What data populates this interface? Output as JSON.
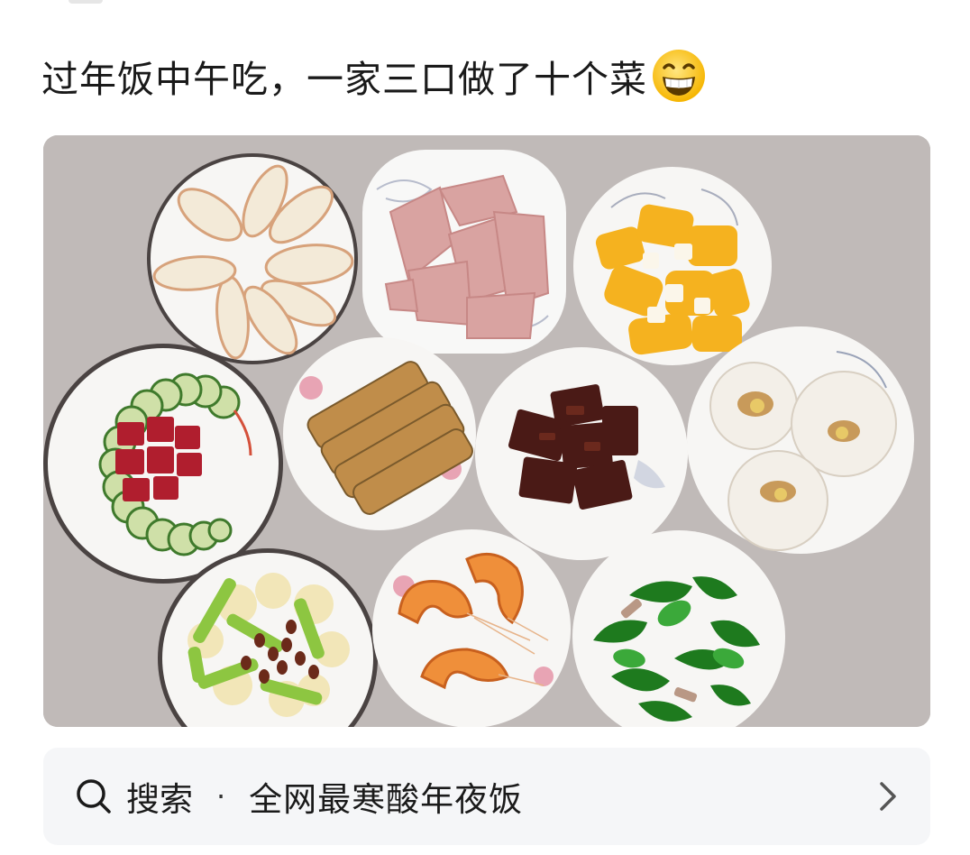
{
  "post": {
    "title": "过年饭中午吃，一家三口做了十个菜",
    "title_emoji": "grinning-face-emoji"
  },
  "photo": {
    "subject": "dishes-photo"
  },
  "search": {
    "label": "搜索",
    "separator": "·",
    "query": "全网最寒酸年夜饭"
  },
  "colors": {
    "text": "#1a1a1a",
    "search_bg": "#f5f6f8",
    "table": "#bdb7b4",
    "plate": "#f7f6f4"
  }
}
